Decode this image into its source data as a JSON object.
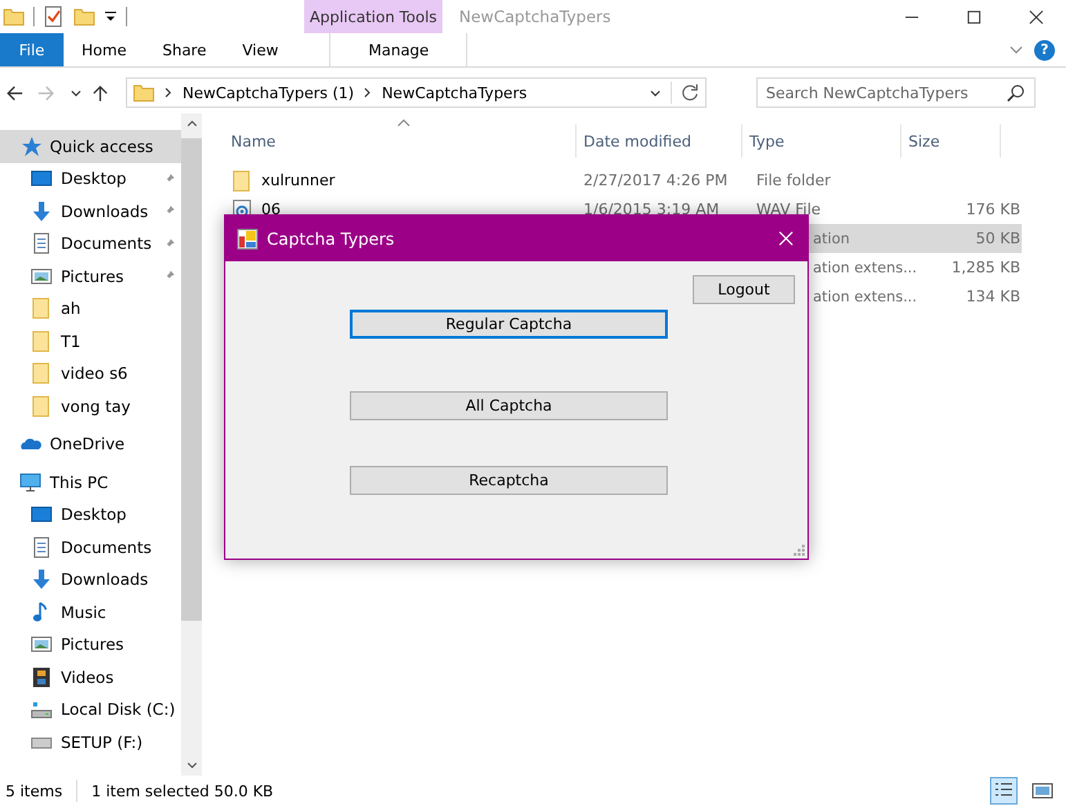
{
  "window": {
    "title": "NewCaptchaTypers",
    "context_tab": "Application Tools"
  },
  "ribbon_tabs": [
    {
      "label": "File",
      "kind": "file"
    },
    {
      "label": "Home",
      "kind": "plain"
    },
    {
      "label": "Share",
      "kind": "plain"
    },
    {
      "label": "View",
      "kind": "plain"
    },
    {
      "label": "Manage",
      "kind": "context"
    }
  ],
  "help": "?",
  "address": {
    "crumbs": [
      "NewCaptchaTypers (1)",
      "NewCaptchaTypers"
    ],
    "search_placeholder": "Search NewCaptchaTypers"
  },
  "sidebar": [
    {
      "label": "Quick access",
      "kind": "star",
      "selected": true,
      "children": [
        {
          "label": "Desktop",
          "kind": "desktop",
          "pinned": true,
          "selected": false
        },
        {
          "label": "Downloads",
          "kind": "download",
          "pinned": true,
          "selected": false
        },
        {
          "label": "Documents",
          "kind": "document",
          "pinned": true,
          "selected": false
        },
        {
          "label": "Pictures",
          "kind": "picture",
          "pinned": true,
          "selected": false
        },
        {
          "label": "ah",
          "kind": "folder",
          "pinned": false,
          "selected": false
        },
        {
          "label": "T1",
          "kind": "folder",
          "pinned": false,
          "selected": false
        },
        {
          "label": "video s6",
          "kind": "folder",
          "pinned": false,
          "selected": false
        },
        {
          "label": "vong tay",
          "kind": "folder",
          "pinned": false,
          "selected": false
        }
      ]
    },
    {
      "label": "OneDrive",
      "kind": "cloud",
      "selected": false
    },
    {
      "label": "This PC",
      "kind": "pc",
      "selected": false,
      "children": [
        {
          "label": "Desktop",
          "kind": "desktop",
          "pinned": false,
          "selected": false
        },
        {
          "label": "Documents",
          "kind": "document",
          "pinned": false,
          "selected": false
        },
        {
          "label": "Downloads",
          "kind": "download",
          "pinned": false,
          "selected": false
        },
        {
          "label": "Music",
          "kind": "music",
          "pinned": false,
          "selected": false
        },
        {
          "label": "Pictures",
          "kind": "picture",
          "pinned": false,
          "selected": false
        },
        {
          "label": "Videos",
          "kind": "video",
          "pinned": false,
          "selected": false
        },
        {
          "label": "Local Disk (C:)",
          "kind": "disk",
          "pinned": false,
          "selected": false
        },
        {
          "label": "SETUP (F:)",
          "kind": "drive",
          "pinned": false,
          "selected": false
        }
      ]
    }
  ],
  "table": {
    "columns": [
      "Name",
      "Date modified",
      "Type",
      "Size"
    ],
    "rows": [
      {
        "name": "xulrunner",
        "kind": "folder",
        "date": "2/27/2017 4:26 PM",
        "type": "File folder",
        "size": "",
        "selected": false
      },
      {
        "name": "06",
        "kind": "audio",
        "date": "1/6/2015 3:19 AM",
        "type": "WAV File",
        "size": "176 KB",
        "selected": false
      },
      {
        "name": "",
        "kind": "hidden",
        "date": "",
        "type": "ation",
        "size": "50 KB",
        "selected": true
      },
      {
        "name": "",
        "kind": "hidden",
        "date": "",
        "type": "ation extens...",
        "size": "1,285 KB",
        "selected": false
      },
      {
        "name": "",
        "kind": "hidden",
        "date": "",
        "type": "ation extens...",
        "size": "134 KB",
        "selected": false
      }
    ]
  },
  "status_bar": {
    "count": "5 items",
    "selection": "1 item selected  50.0 KB",
    "views": [
      {
        "kind": "details",
        "selected": true
      },
      {
        "kind": "tiles",
        "selected": false
      }
    ]
  },
  "dialog": {
    "title": "Captcha Typers",
    "logout": "Logout",
    "buttons": [
      {
        "label": "Regular Captcha",
        "focused": true
      },
      {
        "label": "All Captcha",
        "focused": false
      },
      {
        "label": "Recaptcha",
        "focused": false
      }
    ]
  }
}
